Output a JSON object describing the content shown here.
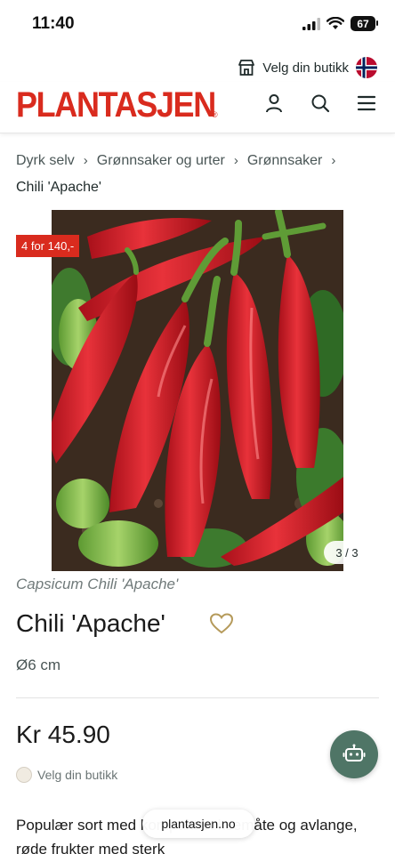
{
  "status_bar": {
    "time": "11:40",
    "battery": "67"
  },
  "store_bar": {
    "label": "Velg din butikk"
  },
  "header": {
    "logo": "PLANTASJEN",
    "logo_mark": "®"
  },
  "breadcrumb": {
    "items": [
      "Dyrk selv",
      "Grønnsaker og urter",
      "Grønnsaker"
    ],
    "current": "Chili 'Apache'"
  },
  "gallery": {
    "promo": "4 for 140,-",
    "counter": "3 / 3"
  },
  "product": {
    "latin_name": "Capsicum Chili 'Apache'",
    "title": "Chili 'Apache'",
    "size": "Ø6 cm",
    "price": "Kr 45.90",
    "store_select": "Velg din butikk",
    "description": "Populær sort med kompakt voksemåte og avlange, røde frukter med sterk"
  },
  "browser": {
    "url": "plantasjen.no"
  },
  "colors": {
    "brand_red": "#d92b1e",
    "accent_green": "#4f7566",
    "heart_gold": "#b59a5a"
  }
}
